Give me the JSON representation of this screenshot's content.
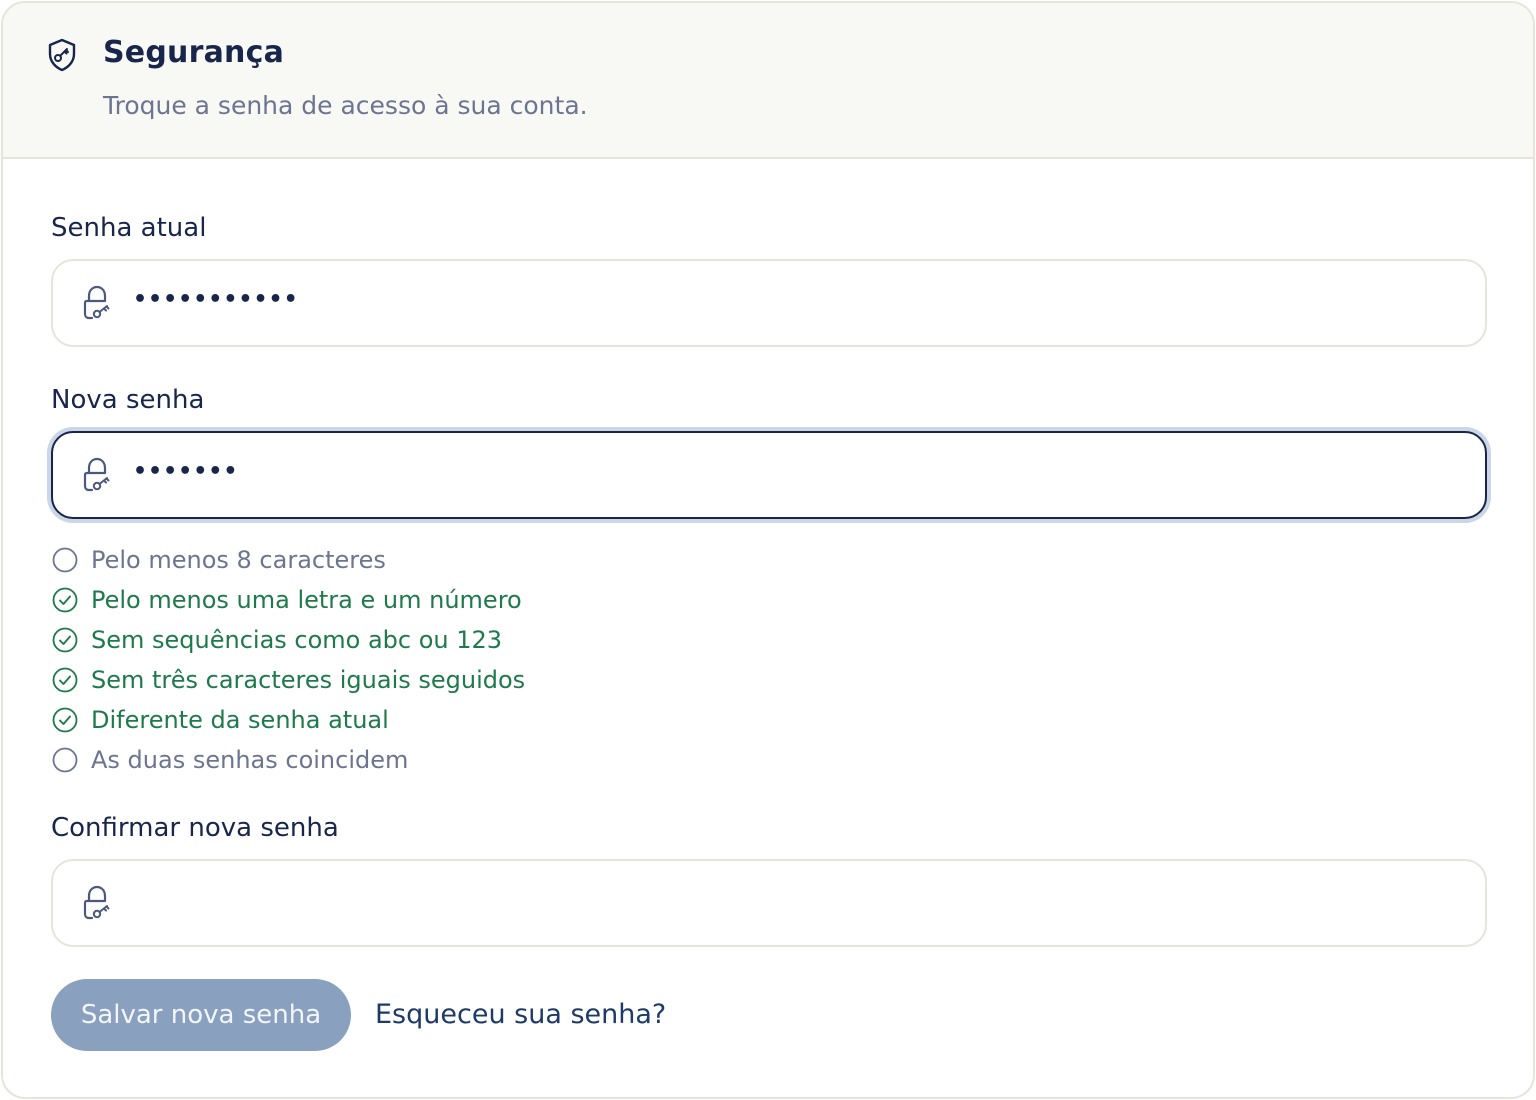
{
  "header": {
    "title": "Segurança",
    "subtitle": "Troque a senha de acesso à sua conta.",
    "icon": "shield-key-icon"
  },
  "fields": {
    "current": {
      "label": "Senha atual",
      "value": "•••••••••••",
      "icon": "lock-key-icon"
    },
    "new": {
      "label": "Nova senha",
      "value": "•••••••",
      "icon": "lock-key-icon",
      "focused": true
    },
    "confirm": {
      "label": "Confirmar nova senha",
      "value": "",
      "icon": "lock-key-icon"
    }
  },
  "rules": [
    {
      "text": "Pelo menos 8 caracteres",
      "met": false
    },
    {
      "text": "Pelo menos uma letra e um número",
      "met": true
    },
    {
      "text": "Sem sequências como abc ou 123",
      "met": true
    },
    {
      "text": "Sem três caracteres iguais seguidos",
      "met": true
    },
    {
      "text": "Diferente da senha atual",
      "met": true
    },
    {
      "text": "As duas senhas coincidem",
      "met": false
    }
  ],
  "actions": {
    "save_label": "Salvar nova senha",
    "save_disabled": true,
    "forgot_label": "Esqueceu sua senha?"
  },
  "colors": {
    "primary": "#17264a",
    "muted": "#6c7590",
    "success": "#1f7a4b",
    "disabled_button": "#8aa0bf",
    "border": "#e6e5dc",
    "header_bg": "#f8f8f5"
  }
}
